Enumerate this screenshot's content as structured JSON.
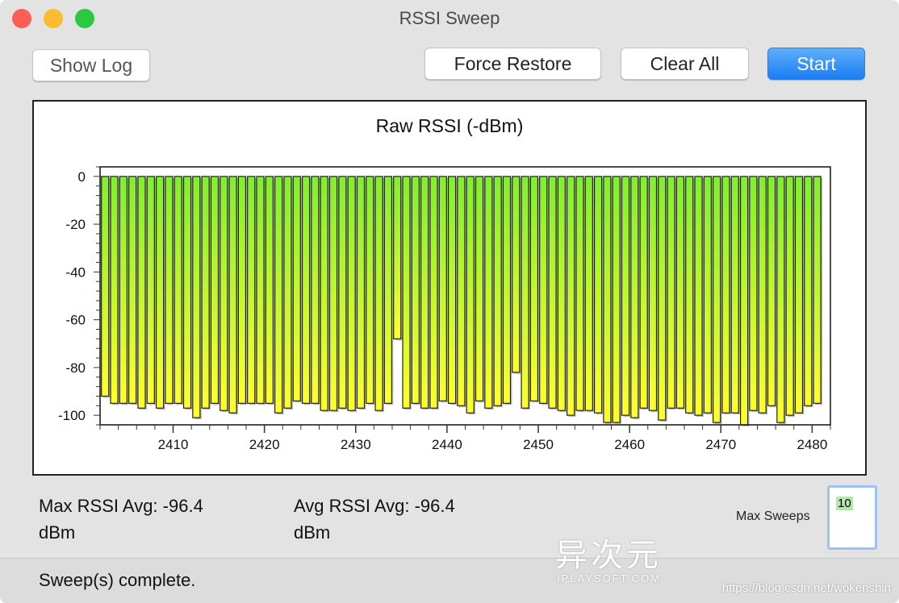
{
  "window": {
    "title": "RSSI Sweep",
    "lights": {
      "close": "#fd5f57",
      "minimize": "#fdbb2e",
      "zoom": "#2ac940"
    }
  },
  "toolbar": {
    "show_log": "Show Log",
    "force_restore": "Force Restore",
    "clear_all": "Clear All",
    "start": "Start"
  },
  "chart_data": {
    "type": "bar",
    "title": "Raw RSSI (-dBm)",
    "xlabel": "",
    "ylabel": "",
    "xlim": [
      2402,
      2482
    ],
    "ylim": [
      -104,
      4
    ],
    "x_ticks": [
      2410,
      2420,
      2430,
      2440,
      2450,
      2460,
      2470,
      2480
    ],
    "y_ticks": [
      0,
      -20,
      -40,
      -60,
      -80,
      -100
    ],
    "bar_baseline": 0,
    "colors": {
      "top": "#7ff02a",
      "bottom": "#ffff2a",
      "outline": "#222222"
    },
    "x": [
      2402,
      2403,
      2404,
      2405,
      2406,
      2407,
      2408,
      2409,
      2410,
      2411,
      2412,
      2413,
      2414,
      2415,
      2416,
      2417,
      2418,
      2419,
      2420,
      2421,
      2422,
      2423,
      2424,
      2425,
      2426,
      2427,
      2428,
      2429,
      2430,
      2431,
      2432,
      2433,
      2434,
      2435,
      2436,
      2437,
      2438,
      2439,
      2440,
      2441,
      2442,
      2443,
      2444,
      2445,
      2446,
      2447,
      2448,
      2449,
      2450,
      2451,
      2452,
      2453,
      2454,
      2455,
      2456,
      2457,
      2458,
      2459,
      2460,
      2461,
      2462,
      2463,
      2464,
      2465,
      2466,
      2467,
      2468,
      2469,
      2470,
      2471,
      2472,
      2473,
      2474,
      2475,
      2476,
      2477,
      2478,
      2479,
      2480
    ],
    "values": [
      -92,
      -95,
      -95,
      -95,
      -97,
      -95,
      -97,
      -95,
      -95,
      -97,
      -101,
      -97,
      -95,
      -98,
      -99,
      -95,
      -95,
      -95,
      -95,
      -99,
      -97,
      -94,
      -95,
      -95,
      -98,
      -98,
      -97,
      -98,
      -97,
      -95,
      -98,
      -95,
      -68,
      -97,
      -95,
      -97,
      -97,
      -94,
      -95,
      -96,
      -99,
      -94,
      -97,
      -96,
      -95,
      -82,
      -97,
      -94,
      -95,
      -97,
      -98,
      -100,
      -98,
      -98,
      -99,
      -103,
      -103,
      -100,
      -101,
      -97,
      -98,
      -102,
      -97,
      -97,
      -99,
      -100,
      -99,
      -103,
      -99,
      -99,
      -104,
      -98,
      -99,
      -96,
      -103,
      -100,
      -99,
      -96,
      -95
    ],
    "grid": false
  },
  "stats": {
    "max_rssi": "Max RSSI Avg: -96.4",
    "max_unit": "dBm",
    "avg_rssi": "Avg RSSI Avg: -96.4",
    "avg_unit": "dBm"
  },
  "max_sweeps": {
    "label": "Max Sweeps",
    "value": "10"
  },
  "status": {
    "text": "Sweep(s) complete."
  },
  "watermark": {
    "logo": "异次元",
    "site": "IPLAYSOFT.COM",
    "url": "https://blog.csdn.net/wokenshin"
  }
}
